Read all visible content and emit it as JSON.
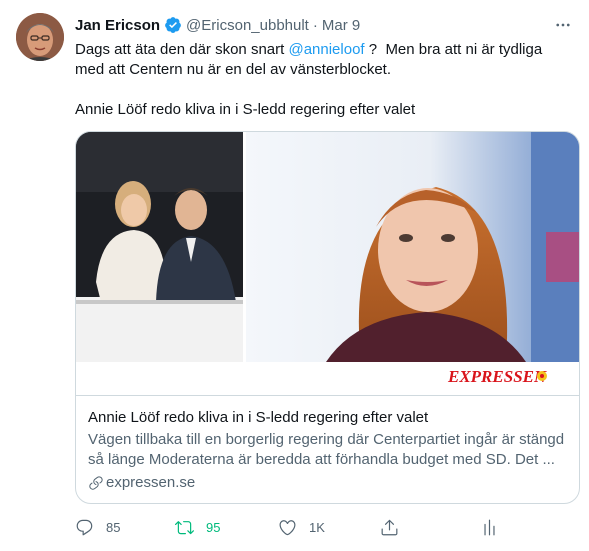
{
  "tweet": {
    "author_name": "Jan Ericson",
    "author_handle": "@Ericson_ubbhult",
    "separator": "·",
    "date": "Mar 9",
    "text_before_mention": "Dags att äta den där skon snart ",
    "mention": "@annieloof",
    "text_after_mention": " ?  Men bra att ni är tydliga med att Centern nu är en del av vänsterblocket.",
    "text_second_paragraph": "Annie Lööf redo kliva in i S-ledd regering efter valet"
  },
  "card": {
    "brand_logo_text": "EXPRESSEN",
    "title": "Annie Lööf redo kliva in i S-ledd regering efter valet",
    "description": "Vägen tillbaka till en borgerlig regering där Centerpartiet ingår är stängd så länge Moderaterna är beredda att förhandla budget med SD. Det ...",
    "domain": "expressen.se"
  },
  "actions": {
    "reply_count": "85",
    "retweet_count": "95",
    "like_count": "1K"
  },
  "icons": {
    "verified": "verified-badge-icon",
    "more": "more-icon",
    "reply": "reply-icon",
    "retweet": "retweet-icon",
    "like": "heart-icon",
    "share": "share-icon",
    "analytics": "analytics-icon",
    "link": "link-icon"
  },
  "colors": {
    "accent": "#1d9bf0",
    "retweet_active": "#00ba7c",
    "secondary_text": "#536471",
    "border": "#cfd9de",
    "brand_red": "#d9141b"
  }
}
